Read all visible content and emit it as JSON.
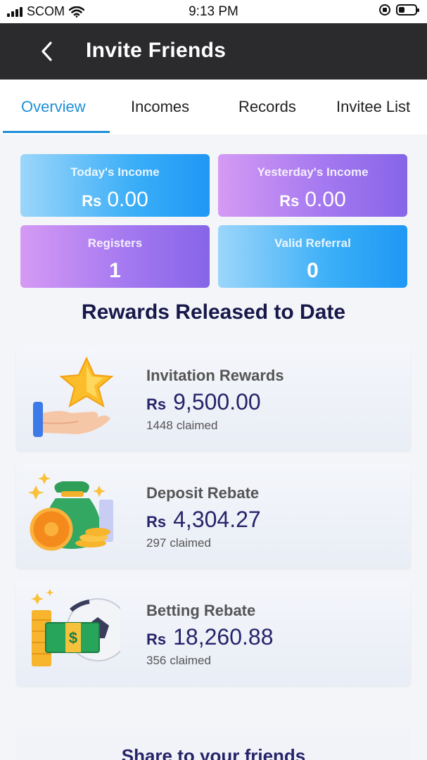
{
  "status_bar": {
    "carrier": "SCOM",
    "time": "9:13 PM",
    "battery_level": 0.25
  },
  "header": {
    "title": "Invite Friends",
    "back_icon": "chevron-left-icon"
  },
  "tabs": [
    {
      "label": "Overview",
      "active": true
    },
    {
      "label": "Incomes",
      "active": false
    },
    {
      "label": "Records",
      "active": false
    },
    {
      "label": "Invitee List",
      "active": false
    }
  ],
  "stats": {
    "todays_income": {
      "label": "Today's Income",
      "currency": "Rs",
      "value": "0.00"
    },
    "yesterdays_income": {
      "label": "Yesterday's Income",
      "currency": "Rs",
      "value": "0.00"
    },
    "registers": {
      "label": "Registers",
      "value": "1"
    },
    "valid_referral": {
      "label": "Valid Referral",
      "value": "0"
    }
  },
  "section_title": "Rewards Released to Date",
  "rewards": [
    {
      "name": "Invitation Rewards",
      "currency": "Rs",
      "amount": "9,500.00",
      "claimed_count": "1448",
      "claimed_label": "claimed",
      "icon": "star-hand-icon"
    },
    {
      "name": "Deposit Rebate",
      "currency": "Rs",
      "amount": "4,304.27",
      "claimed_count": "297",
      "claimed_label": "claimed",
      "icon": "money-bag-icon"
    },
    {
      "name": "Betting Rebate",
      "currency": "Rs",
      "amount": "18,260.88",
      "claimed_count": "356",
      "claimed_label": "claimed",
      "icon": "football-cash-icon"
    }
  ],
  "share": {
    "label": "Share to your friends"
  },
  "colors": {
    "header_bg": "#2b2b2e",
    "tab_active": "#1e8fd8",
    "amount_text": "#27236a",
    "title_text": "#17174a"
  }
}
